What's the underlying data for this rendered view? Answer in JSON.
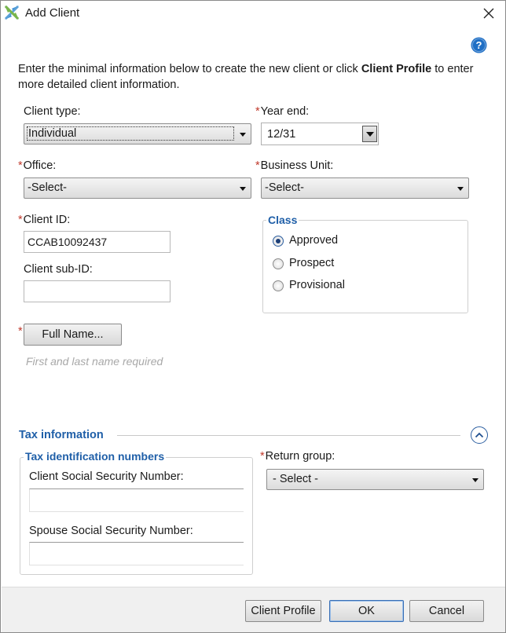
{
  "window": {
    "title": "Add Client"
  },
  "intro": {
    "part1": "Enter the minimal information below to create the new client or click ",
    "bold": "Client Profile",
    "part2": " to enter more detailed client information."
  },
  "client_type": {
    "label": "Client type:",
    "value": "Individual"
  },
  "year_end": {
    "label": "Year end:",
    "value": "12/31"
  },
  "office": {
    "label": "Office:",
    "value": "-Select-"
  },
  "business_unit": {
    "label": "Business Unit:",
    "value": "-Select-"
  },
  "client_id": {
    "label": "Client ID:",
    "value": "CCAB10092437"
  },
  "client_sub_id": {
    "label": "Client sub-ID:",
    "value": ""
  },
  "class": {
    "title": "Class",
    "options": [
      {
        "label": "Approved",
        "checked": true
      },
      {
        "label": "Prospect",
        "checked": false
      },
      {
        "label": "Provisional",
        "checked": false
      }
    ]
  },
  "full_name": {
    "button": "Full Name...",
    "hint": "First and last name required"
  },
  "tax_info": {
    "title": "Tax information",
    "tin_group_title": "Tax identification numbers",
    "client_ssn_label": "Client Social Security Number:",
    "client_ssn_value": "",
    "spouse_ssn_label": "Spouse Social Security Number:",
    "spouse_ssn_value": "",
    "return_group": {
      "label": "Return group:",
      "value": "- Select -"
    }
  },
  "footer": {
    "client_profile": "Client Profile",
    "ok": "OK",
    "cancel": "Cancel"
  },
  "required_marker": "*",
  "colors": {
    "accent": "#1f5fa8",
    "required": "#c0392b",
    "hint": "#a8a8a8"
  }
}
